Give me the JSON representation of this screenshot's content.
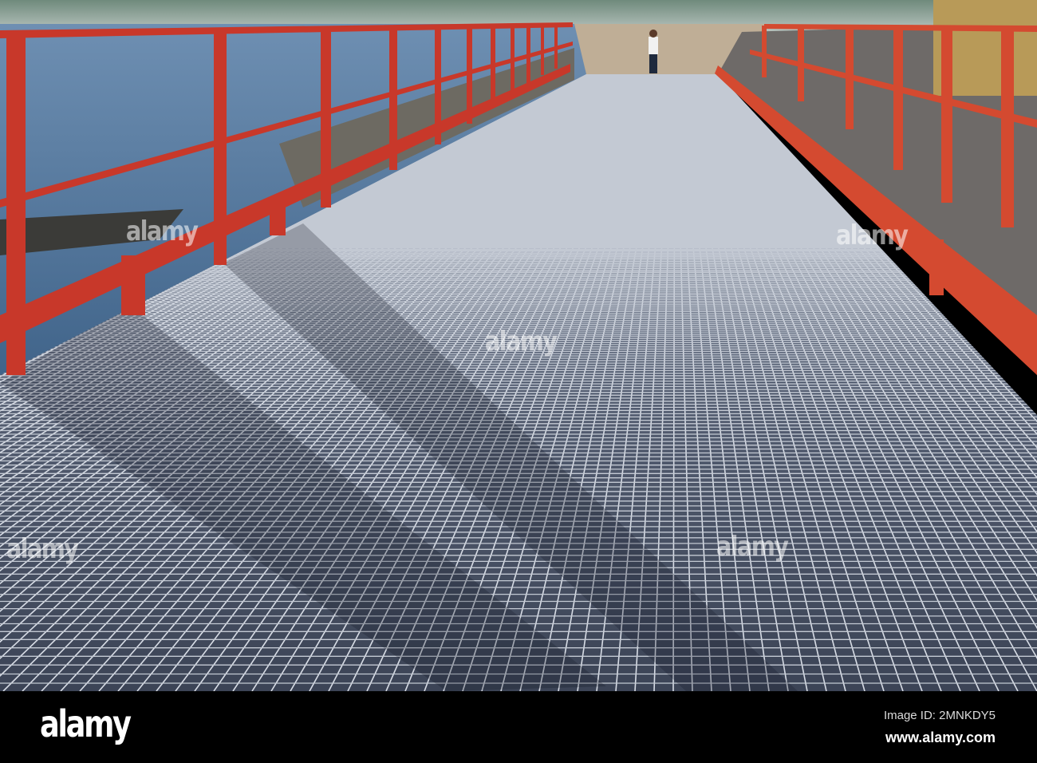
{
  "photo": {
    "subject": "steel grating walkway",
    "colors": {
      "railing": "#c8382a",
      "water": "#4a6f94",
      "grating": "#5c6678",
      "sky": "#9fb0ad"
    }
  },
  "watermarks": [
    "alamy",
    "alamy",
    "alamy",
    "alamy",
    "alamy",
    "alamy"
  ],
  "footer": {
    "logo": "alamy",
    "image_id": "Image ID: 2MNKDY5",
    "website": "www.alamy.com"
  }
}
